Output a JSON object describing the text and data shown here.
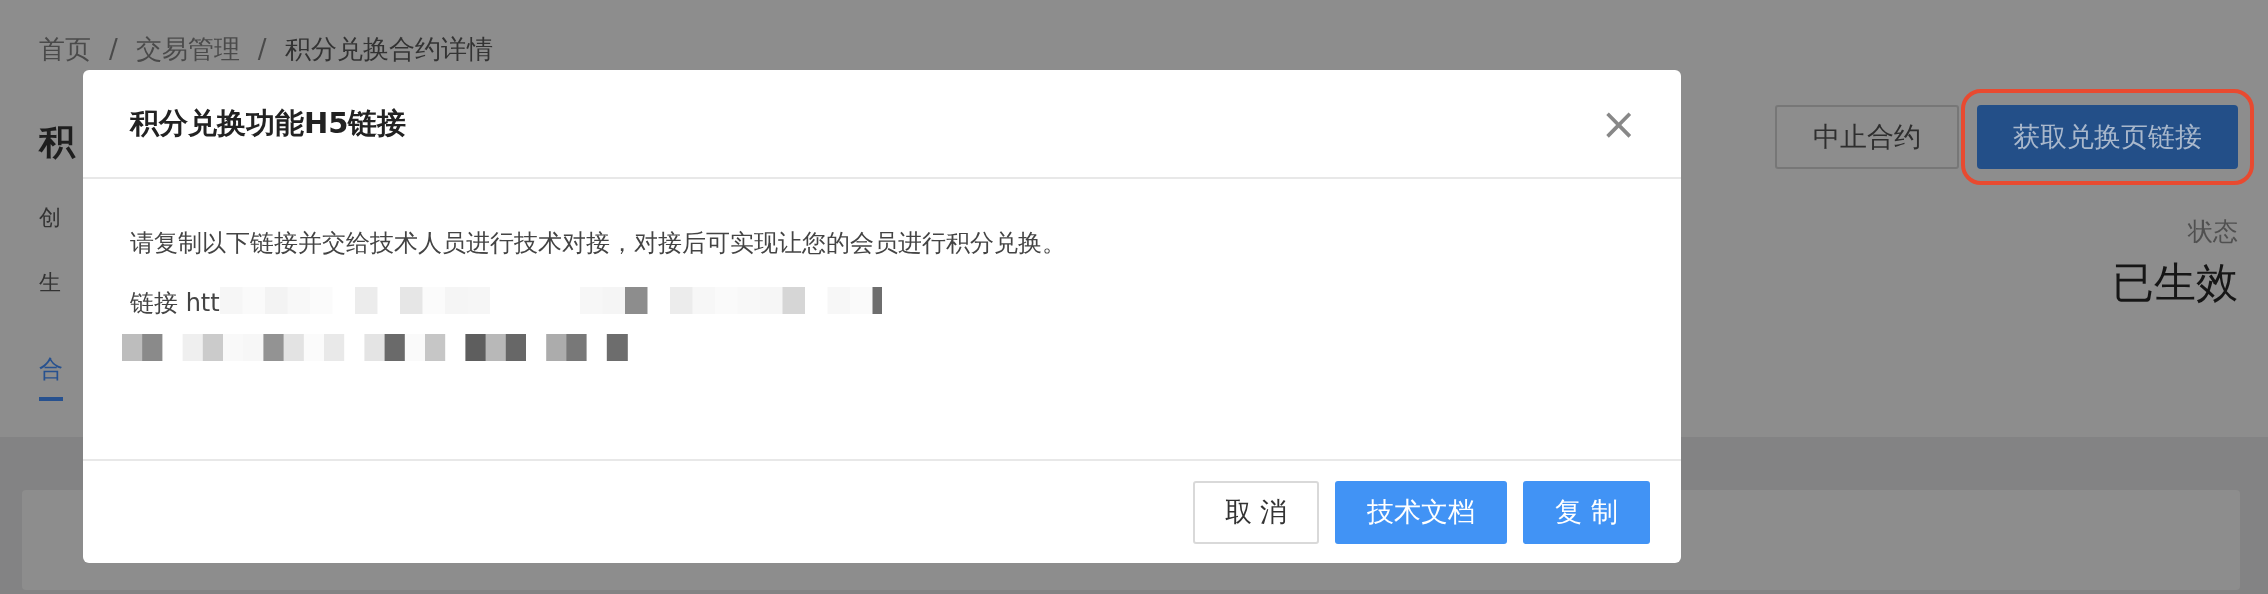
{
  "breadcrumb": [
    {
      "kind": "link",
      "label": "首页"
    },
    {
      "kind": "separator",
      "label": "/"
    },
    {
      "kind": "link",
      "label": "交易管理"
    },
    {
      "kind": "separator",
      "label": "/"
    },
    {
      "kind": "current",
      "label": "积分兑换合约详情"
    }
  ],
  "page_title": "积",
  "info_labels": [
    "创",
    "生"
  ],
  "tabs": [
    {
      "label": "合",
      "selected": true
    }
  ],
  "actions": [
    {
      "label": "中止合约",
      "kind": "default",
      "highlighted": false
    },
    {
      "label": "获取兑换页链接",
      "kind": "primary",
      "highlighted": true
    }
  ],
  "status": {
    "label": "状态",
    "value": "已生效"
  },
  "modal": {
    "title": "积分兑换功能H5链接",
    "close": "×",
    "message": "请复制以下链接并交给技术人员进行技术对接，对接后可实现让您的会员进行积分兑换。",
    "link_label": "链接 htt",
    "buttons": [
      {
        "label": "取 消",
        "kind": "default"
      },
      {
        "label": "技术文档",
        "kind": "primary"
      },
      {
        "label": "复 制",
        "kind": "primary"
      }
    ]
  }
}
